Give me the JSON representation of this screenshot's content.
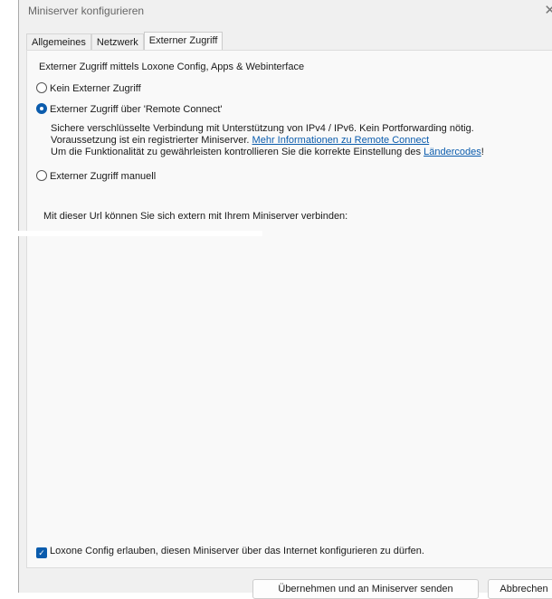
{
  "window": {
    "title": "Miniserver konfigurieren",
    "close": "✕"
  },
  "tabs": [
    {
      "label": "Allgemeines"
    },
    {
      "label": "Netzwerk"
    },
    {
      "label": "Externer Zugriff",
      "active": true
    }
  ],
  "section_heading": "Externer Zugriff mittels Loxone Config, Apps & Webinterface",
  "options": [
    {
      "label": "Kein Externer Zugriff",
      "selected": false
    },
    {
      "label": "Externer Zugriff über 'Remote Connect'",
      "selected": true
    },
    {
      "label": "Externer Zugriff manuell",
      "selected": false
    }
  ],
  "remote_connect": {
    "line1": "Sichere verschlüsselte Verbindung mit Unterstützung von IPv4 / IPv6. Kein Portforwarding nötig.",
    "line2_text": "Voraussetzung ist ein registrierter Miniserver. ",
    "line2_link": "Mehr Informationen zu Remote Connect",
    "line3_text": "Um die Funktionalität zu gewährleisten kontrollieren Sie die korrekte Einstellung des ",
    "line3_link": "Ländercodes",
    "line3_end": "!"
  },
  "url_label": "Mit dieser Url können Sie sich extern mit Ihrem Miniserver verbinden:",
  "allow_config": {
    "label": "Loxone Config erlauben, diesen Miniserver über das Internet konfigurieren zu dürfen.",
    "checked": true
  },
  "buttons": {
    "apply": "Übernehmen und an Miniserver senden",
    "cancel": "Abbrechen"
  }
}
